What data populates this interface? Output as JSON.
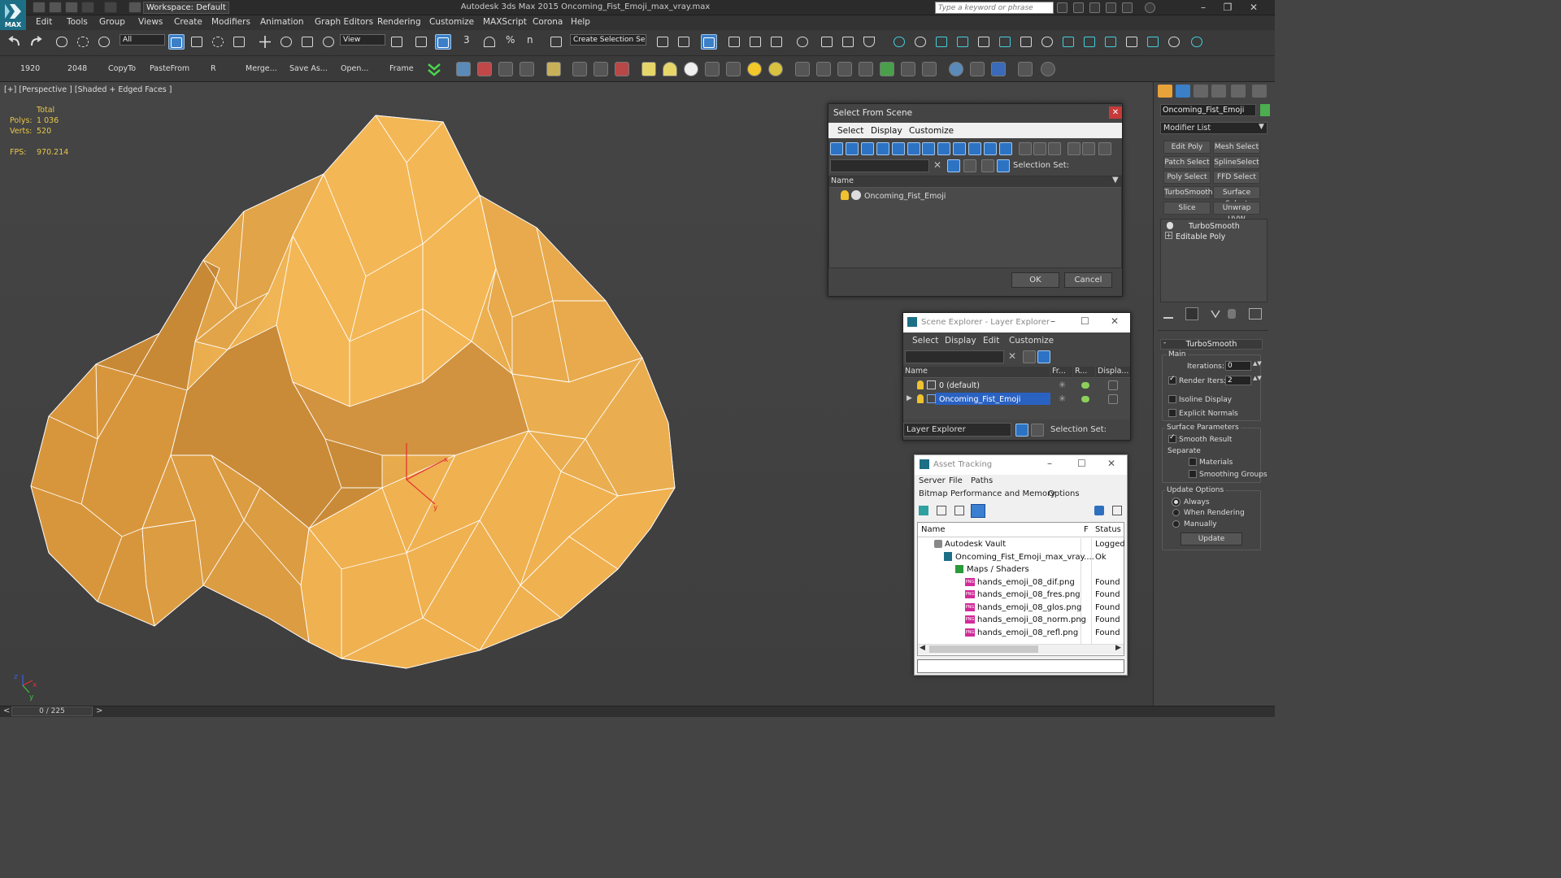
{
  "app": {
    "title": "Autodesk 3ds Max  2015    Oncoming_Fist_Emoji_max_vray.max",
    "workspace": "Workspace: Default",
    "search_placeholder": "Type a keyword or phrase",
    "logo_text": "MAX"
  },
  "menu": [
    "Edit",
    "Tools",
    "Group",
    "Views",
    "Create",
    "Modifiers",
    "Animation",
    "Graph Editors",
    "Rendering",
    "Customize",
    "MAXScript",
    "Corona",
    "Help"
  ],
  "toolbar": {
    "filter_value": "All",
    "coord_value": "View",
    "selection_set_placeholder": "Create Selection Se",
    "snap_labels": [
      "3",
      "%",
      "n"
    ]
  },
  "shelf": [
    "1920",
    "2048",
    "CopyTo",
    "PasteFrom",
    "R",
    "Merge...",
    "Save As...",
    "Open...",
    "Frame"
  ],
  "viewport": {
    "label": "[+] [Perspective ] [Shaded + Edged Faces ]",
    "stats": {
      "total_label": "Total",
      "polys_label": "Polys:",
      "polys": "1 036",
      "verts_label": "Verts:",
      "verts": "520",
      "fps_label": "FPS:",
      "fps": "970.214"
    },
    "gizmo": {
      "x": "x",
      "y": "y",
      "z": "z"
    },
    "colors": {
      "mesh": "#e6a64a",
      "wire": "#ffffff",
      "gizmo_x": "#e03030",
      "gizmo_y": "#40c040"
    }
  },
  "select_from_scene": {
    "title": "Select From Scene",
    "menus": [
      "Select",
      "Display",
      "Customize"
    ],
    "selection_set_label": "Selection Set:",
    "col_name": "Name",
    "items": [
      "Oncoming_Fist_Emoji"
    ],
    "ok": "OK",
    "cancel": "Cancel"
  },
  "scene_explorer": {
    "title": "Scene Explorer - Layer Explorer",
    "menus": [
      "Select",
      "Display",
      "Edit",
      "Customize"
    ],
    "columns": [
      "Name",
      "Fr...",
      "R...",
      "Displa..."
    ],
    "rows": [
      "0 (default)",
      "Oncoming_Fist_Emoji"
    ],
    "footer_combo": "Layer Explorer",
    "selection_set_label": "Selection Set:"
  },
  "asset_tracking": {
    "title": "Asset Tracking",
    "menus": [
      "Server",
      "File",
      "Paths"
    ],
    "menus2": [
      "Bitmap Performance and Memory",
      "Options"
    ],
    "columns": [
      "Name",
      "F",
      "Status"
    ],
    "rows": [
      {
        "name": "Autodesk Vault",
        "status": "Logged"
      },
      {
        "name": "Oncoming_Fist_Emoji_max_vray....",
        "status": "Ok"
      },
      {
        "name": "Maps / Shaders",
        "status": ""
      },
      {
        "name": "hands_emoji_08_dif.png",
        "status": "Found"
      },
      {
        "name": "hands_emoji_08_fres.png",
        "status": "Found"
      },
      {
        "name": "hands_emoji_08_glos.png",
        "status": "Found"
      },
      {
        "name": "hands_emoji_08_norm.png",
        "status": "Found"
      },
      {
        "name": "hands_emoji_08_refl.png",
        "status": "Found"
      }
    ],
    "png_label": "PNG"
  },
  "command_panel": {
    "object_name": "Oncoming_Fist_Emoji",
    "object_color": "#4cae4f",
    "modifier_list": "Modifier List",
    "mod_buttons": [
      "Edit Poly",
      "Mesh Select",
      "Patch Select",
      "SplineSelect",
      "Poly Select",
      "FFD Select",
      "TurboSmooth",
      "Surface Select",
      "Slice",
      "Unwrap UVW"
    ],
    "stack": [
      "TurboSmooth",
      "Editable Poly"
    ],
    "rollout_title": "TurboSmooth",
    "main_label": "Main",
    "iterations_label": "Iterations:",
    "iterations": "0",
    "render_iters_label": "Render Iters:",
    "render_iters": "2",
    "isoline": "Isoline Display",
    "explicit": "Explicit Normals",
    "surface_params": "Surface Parameters",
    "smooth_result": "Smooth Result",
    "separate": "Separate",
    "materials": "Materials",
    "smoothing_groups": "Smoothing Groups",
    "update_options": "Update Options",
    "always": "Always",
    "when_rendering": "When Rendering",
    "manually": "Manually",
    "update": "Update",
    "collapse": "-"
  },
  "timeline": {
    "frame": "0 / 225",
    "prev": "<",
    "next": ">"
  }
}
